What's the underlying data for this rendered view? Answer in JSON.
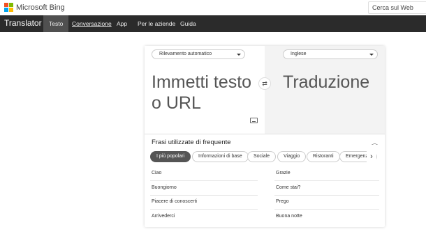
{
  "bing": {
    "brand": "Microsoft Bing",
    "search_placeholder": "Cerca sul Web",
    "logo_colors": [
      "#f25022",
      "#7fba00",
      "#00a4ef",
      "#ffb900"
    ]
  },
  "nav": {
    "title": "Translator",
    "items": [
      "Testo",
      "Conversazione",
      "App",
      "Per le aziende",
      "Guida"
    ]
  },
  "translator": {
    "source_lang": "Rilevamento automatico",
    "target_lang": "Inglese",
    "source_placeholder": "Immetti testo o URL",
    "target_placeholder": "Traduzione",
    "swap_icon": "⇄"
  },
  "phrases": {
    "heading": "Frasi utilizzate di frequente",
    "categories": [
      "I più popolari",
      "Informazioni di base",
      "Sociale",
      "Viaggio",
      "Ristoranti",
      "Emergenze"
    ],
    "left": [
      "Ciao",
      "Buongiorno",
      "Piacere di conoscerti",
      "Arrivederci"
    ],
    "right": [
      "Grazie",
      "Come stai?",
      "Prego",
      "Buona notte"
    ]
  },
  "colors": {
    "nav_bg": "#2b2b2b",
    "active_tab": "#505050",
    "active_chip": "#555555"
  }
}
